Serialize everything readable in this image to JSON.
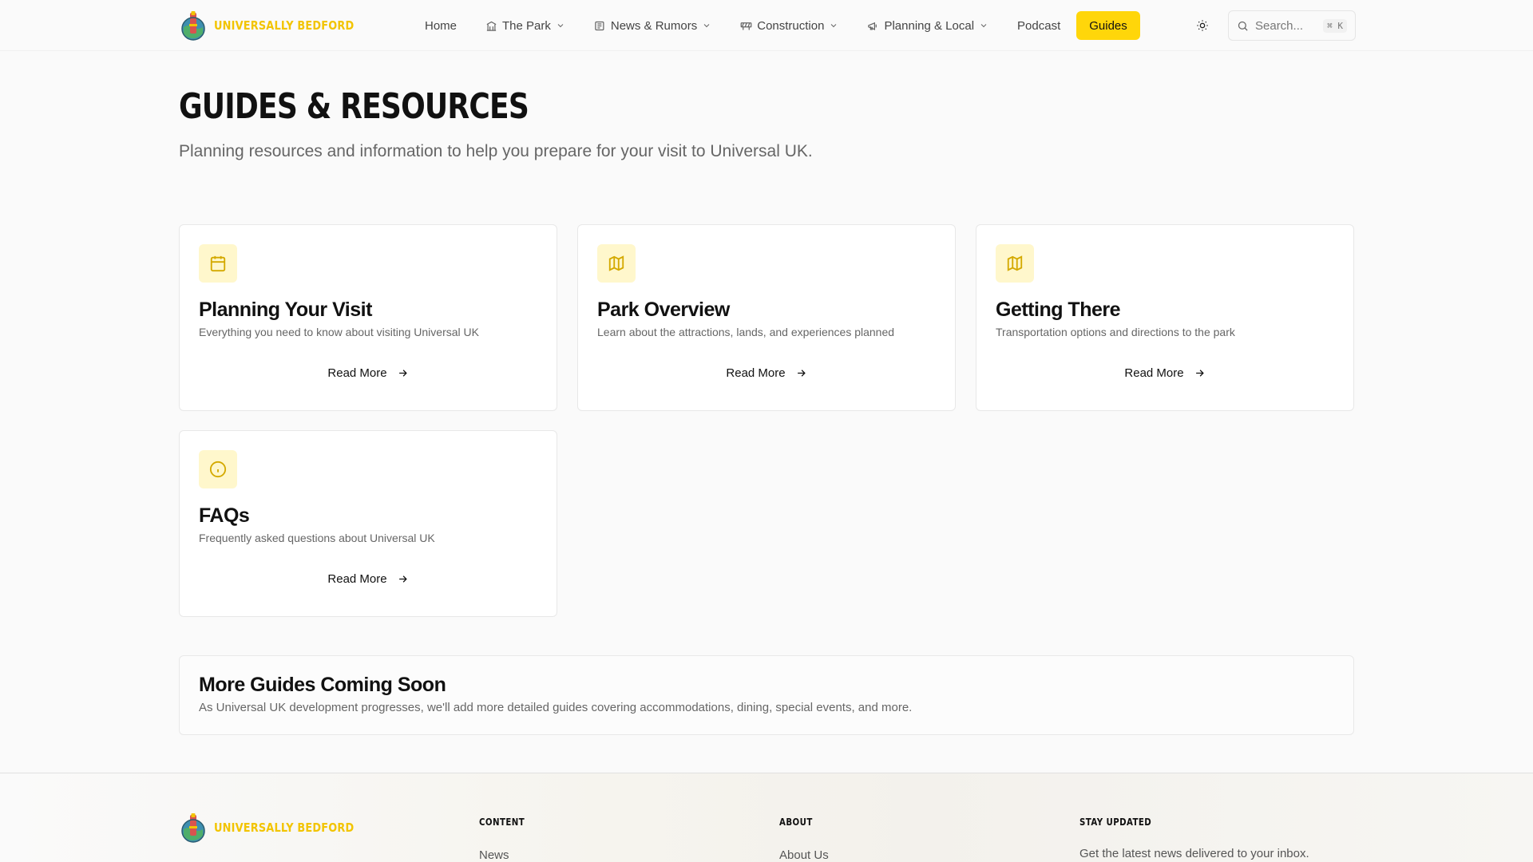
{
  "brand": {
    "name": "UNIVERSALLY BEDFORD"
  },
  "nav": {
    "items": [
      {
        "label": "Home",
        "icon": "",
        "dropdown": false
      },
      {
        "label": "The Park",
        "icon": "building-icon",
        "dropdown": true
      },
      {
        "label": "News & Rumors",
        "icon": "newspaper-icon",
        "dropdown": true
      },
      {
        "label": "Construction",
        "icon": "construction-icon",
        "dropdown": true
      },
      {
        "label": "Planning & Local",
        "icon": "megaphone-icon",
        "dropdown": true
      },
      {
        "label": "Podcast",
        "icon": "",
        "dropdown": false
      },
      {
        "label": "Guides",
        "icon": "",
        "dropdown": false,
        "active": true
      }
    ],
    "theme_icon": "sun-icon",
    "search_placeholder": "Search...",
    "search_shortcut": "⌘ K"
  },
  "page": {
    "title": "GUIDES & RESOURCES",
    "subtitle": "Planning resources and information to help you prepare for your visit to Universal UK."
  },
  "cards": [
    {
      "icon": "calendar-icon",
      "title": "Planning Your Visit",
      "description": "Everything you need to know about visiting Universal UK",
      "link": "Read More"
    },
    {
      "icon": "map-icon",
      "title": "Park Overview",
      "description": "Learn about the attractions, lands, and experiences planned",
      "link": "Read More"
    },
    {
      "icon": "map-icon",
      "title": "Getting There",
      "description": "Transportation options and directions to the park",
      "link": "Read More"
    },
    {
      "icon": "info-icon",
      "title": "FAQs",
      "description": "Frequently asked questions about Universal UK",
      "link": "Read More"
    }
  ],
  "coming_soon": {
    "title": "More Guides Coming Soon",
    "description": "As Universal UK development progresses, we'll add more detailed guides covering accommodations, dining, special events, and more."
  },
  "footer": {
    "brand_name": "UNIVERSALLY BEDFORD",
    "columns": [
      {
        "heading": "CONTENT",
        "first": "News"
      },
      {
        "heading": "ABOUT",
        "first": "About Us"
      },
      {
        "heading": "STAY UPDATED",
        "first": "Get the latest news delivered to your inbox."
      }
    ]
  },
  "colors": {
    "accent": "#ffd60a",
    "brand_text": "#f2c400",
    "icon_bg": "#fff7cc"
  }
}
